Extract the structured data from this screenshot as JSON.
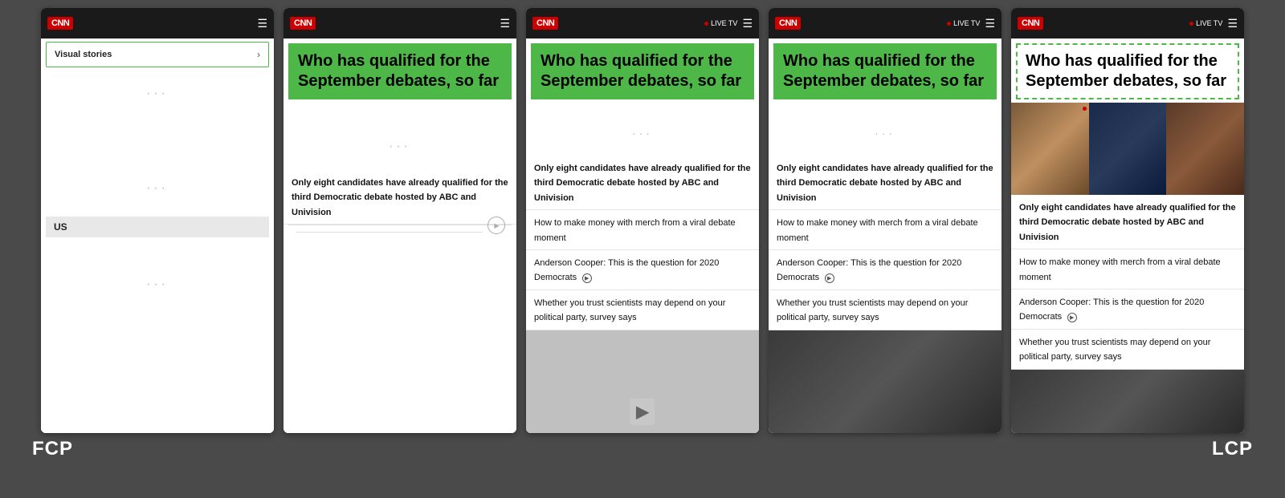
{
  "background_color": "#4a4a4a",
  "labels": {
    "fcp": "FCP",
    "lcp": "LCP"
  },
  "frames": [
    {
      "id": "frame1",
      "navbar": {
        "logo": "CNN",
        "has_live_tv": false,
        "has_hamburger": true
      },
      "type": "visual_stories",
      "visual_stories_label": "Visual stories",
      "arrow": "›",
      "loading_areas": [
        "···",
        "···"
      ],
      "us_label": "US"
    },
    {
      "id": "frame2",
      "navbar": {
        "logo": "CNN",
        "has_live_tv": false,
        "has_hamburger": true
      },
      "type": "article",
      "headline": "Who has qualified for the September debates, so far",
      "headline_highlighted": true,
      "sub_text": "Only eight candidates have already qualified for the third Democratic debate hosted by ABC and Univision",
      "has_video_btn": true,
      "stories": []
    },
    {
      "id": "frame3",
      "navbar": {
        "logo": "CNN",
        "has_live_tv": true,
        "live_tv_label": "LIVE TV",
        "has_hamburger": true
      },
      "type": "article_with_stories",
      "headline": "Who has qualified for the September debates, so far",
      "headline_highlighted": true,
      "sub_text": "Only eight candidates have already qualified for the third Democratic debate hosted by ABC and Univision",
      "stories": [
        "How to make money with merch from a viral debate moment",
        "Anderson Cooper: This is the question for 2020 Democrats",
        "Whether you trust scientists may depend on your political party, survey says"
      ],
      "has_bottom_image": true,
      "bottom_image_type": "gray"
    },
    {
      "id": "frame4",
      "navbar": {
        "logo": "CNN",
        "has_live_tv": true,
        "live_tv_label": "LIVE TV",
        "has_hamburger": true
      },
      "type": "article_with_stories",
      "headline": "Who has qualified for the September debates, so far",
      "headline_highlighted": true,
      "sub_text": "Only eight candidates have already qualified for the third Democratic debate hosted by ABC and Univision",
      "stories": [
        "How to make money with merch from a viral debate moment",
        "Anderson Cooper: This is the question for 2020 Democrats",
        "Whether you trust scientists may depend on your political party, survey says"
      ],
      "has_bottom_image": true,
      "bottom_image_type": "dark"
    },
    {
      "id": "frame5",
      "navbar": {
        "logo": "CNN",
        "has_live_tv": true,
        "live_tv_label": "LIVE TV",
        "has_hamburger": true
      },
      "type": "article_with_image_and_stories",
      "headline": "Who has qualified for the September debates, so far",
      "headline_highlighted": false,
      "sub_text": "Only eight candidates have already qualified for the third Democratic debate hosted by ABC and Univision",
      "stories": [
        "How to make money with merch from a viral debate moment",
        "Anderson Cooper: This is the question for 2020 Democrats",
        "Whether you trust scientists may depend on your political party, survey says"
      ],
      "has_bottom_image": true,
      "bottom_image_type": "dark"
    }
  ]
}
